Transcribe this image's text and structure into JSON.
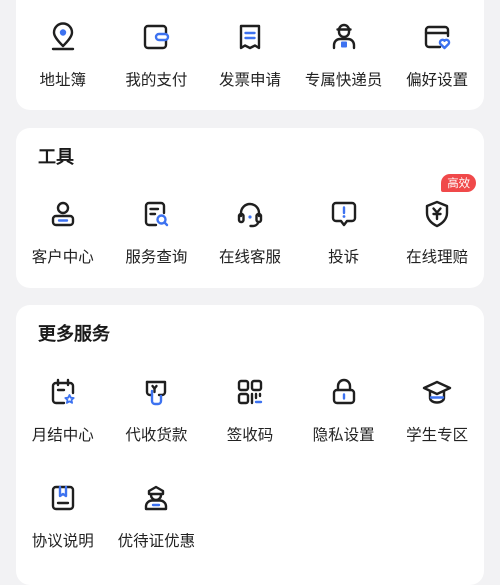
{
  "top_row": {
    "items": [
      {
        "label": "地址簿",
        "icon": "location-pin-icon"
      },
      {
        "label": "我的支付",
        "icon": "wallet-icon"
      },
      {
        "label": "发票申请",
        "icon": "receipt-icon"
      },
      {
        "label": "专属快递员",
        "icon": "courier-icon"
      },
      {
        "label": "偏好设置",
        "icon": "preference-heart-icon"
      }
    ]
  },
  "tools": {
    "title": "工具",
    "items": [
      {
        "label": "客户中心",
        "icon": "user-center-icon"
      },
      {
        "label": "服务查询",
        "icon": "service-search-icon"
      },
      {
        "label": "在线客服",
        "icon": "headset-icon"
      },
      {
        "label": "投诉",
        "icon": "complaint-icon"
      },
      {
        "label": "在线理赔",
        "icon": "claim-shield-icon",
        "badge": "高效"
      }
    ]
  },
  "more_services": {
    "title": "更多服务",
    "items": [
      {
        "label": "月结中心",
        "icon": "calendar-star-icon"
      },
      {
        "label": "代收货款",
        "icon": "collect-payment-icon"
      },
      {
        "label": "签收码",
        "icon": "qr-code-icon"
      },
      {
        "label": "隐私设置",
        "icon": "lock-icon"
      },
      {
        "label": "学生专区",
        "icon": "graduation-cap-icon"
      },
      {
        "label": "协议说明",
        "icon": "agreement-icon"
      },
      {
        "label": "优待证优惠",
        "icon": "officer-icon"
      }
    ]
  },
  "colors": {
    "icon_stroke": "#1f1f1f",
    "accent_blue": "#3d72f0",
    "badge_red": "#f0494a"
  }
}
